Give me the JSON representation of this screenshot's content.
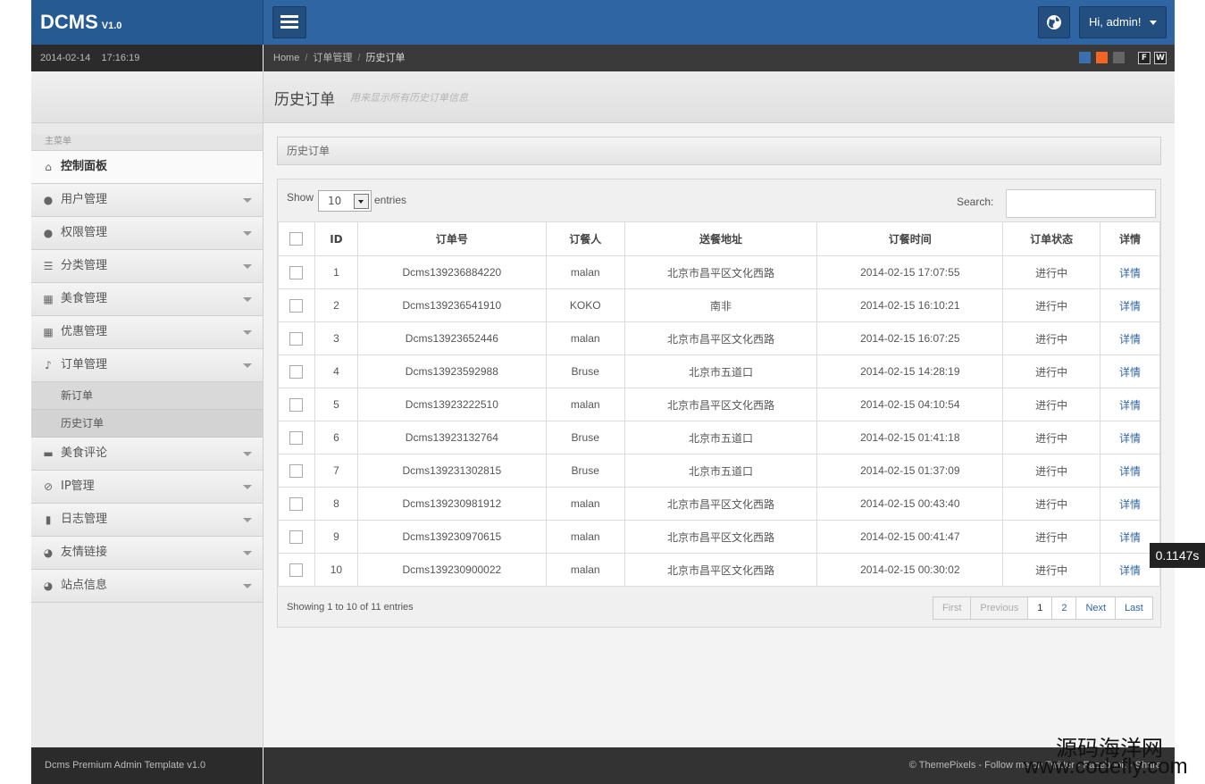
{
  "app": {
    "name": "DCMS",
    "version": "V1.0"
  },
  "header": {
    "datetime": "2014-02-14    17:16:19",
    "user_label": "Hi, admin!"
  },
  "breadcrumb": {
    "home": "Home",
    "section": "订单管理",
    "current": "历史订单"
  },
  "theme_colors": [
    "#3a6fb0",
    "#f26522",
    "#666666"
  ],
  "layout_buttons": [
    "F",
    "W"
  ],
  "sidebar": {
    "heading": "主菜单",
    "items": [
      {
        "label": "控制面板",
        "icon": "home-icon",
        "glyph": "⌂"
      },
      {
        "label": "用户管理",
        "icon": "user-icon",
        "glyph": "●"
      },
      {
        "label": "权限管理",
        "icon": "user-icon",
        "glyph": "●"
      },
      {
        "label": "分类管理",
        "icon": "list-icon",
        "glyph": "☰"
      },
      {
        "label": "美食管理",
        "icon": "grid-icon",
        "glyph": "▦"
      },
      {
        "label": "优惠管理",
        "icon": "grid-icon",
        "glyph": "▦"
      },
      {
        "label": "订单管理",
        "icon": "bell-icon",
        "glyph": "♪"
      }
    ],
    "subitems": [
      {
        "label": "新订单"
      },
      {
        "label": "历史订单"
      }
    ],
    "items2": [
      {
        "label": "美食评论",
        "icon": "comment-icon",
        "glyph": "▬"
      },
      {
        "label": "IP管理",
        "icon": "ban-icon",
        "glyph": "⊘"
      },
      {
        "label": "日志管理",
        "icon": "file-icon",
        "glyph": "▮"
      },
      {
        "label": "友情链接",
        "icon": "globe-icon",
        "glyph": "◕"
      },
      {
        "label": "站点信息",
        "icon": "globe-icon",
        "glyph": "◕"
      }
    ]
  },
  "page": {
    "title": "历史订单",
    "description": "用来显示所有历史订单信息",
    "box_title": "历史订单"
  },
  "table_controls": {
    "show": "Show",
    "length": "10",
    "entries": "entries",
    "search_label": "Search:",
    "search_value": ""
  },
  "table": {
    "headers": [
      "ID",
      "订单号",
      "订餐人",
      "送餐地址",
      "订餐时间",
      "订单状态",
      "详情"
    ],
    "rows": [
      {
        "id": "1",
        "order_no": "Dcms139236884220",
        "customer": "malan",
        "address": "北京市昌平区文化西路",
        "time": "2014-02-15 17:07:55",
        "status": "进行中",
        "detail": "详情"
      },
      {
        "id": "2",
        "order_no": "Dcms139236541910",
        "customer": "KOKO",
        "address": "南非",
        "time": "2014-02-15 16:10:21",
        "status": "进行中",
        "detail": "详情"
      },
      {
        "id": "3",
        "order_no": "Dcms13923652446",
        "customer": "malan",
        "address": "北京市昌平区文化西路",
        "time": "2014-02-15 16:07:25",
        "status": "进行中",
        "detail": "详情"
      },
      {
        "id": "4",
        "order_no": "Dcms13923592988",
        "customer": "Bruse",
        "address": "北京市五道口",
        "time": "2014-02-15 14:28:19",
        "status": "进行中",
        "detail": "详情"
      },
      {
        "id": "5",
        "order_no": "Dcms13923222510",
        "customer": "malan",
        "address": "北京市昌平区文化西路",
        "time": "2014-02-15 04:10:54",
        "status": "进行中",
        "detail": "详情"
      },
      {
        "id": "6",
        "order_no": "Dcms13923132764",
        "customer": "Bruse",
        "address": "北京市五道口",
        "time": "2014-02-15 01:41:18",
        "status": "进行中",
        "detail": "详情"
      },
      {
        "id": "7",
        "order_no": "Dcms139231302815",
        "customer": "Bruse",
        "address": "北京市五道口",
        "time": "2014-02-15 01:37:09",
        "status": "进行中",
        "detail": "详情"
      },
      {
        "id": "8",
        "order_no": "Dcms139230981912",
        "customer": "malan",
        "address": "北京市昌平区文化西路",
        "time": "2014-02-15 00:43:40",
        "status": "进行中",
        "detail": "详情"
      },
      {
        "id": "9",
        "order_no": "Dcms139230970615",
        "customer": "malan",
        "address": "北京市昌平区文化西路",
        "time": "2014-02-15 00:41:47",
        "status": "进行中",
        "detail": "详情"
      },
      {
        "id": "10",
        "order_no": "Dcms139230900022",
        "customer": "malan",
        "address": "北京市昌平区文化西路",
        "time": "2014-02-15 00:30:02",
        "status": "进行中",
        "detail": "详情"
      }
    ]
  },
  "pagination": {
    "info": "Showing 1 to 10 of 11 entries",
    "first": "First",
    "previous": "Previous",
    "pages": [
      "1",
      "2"
    ],
    "next": "Next",
    "last": "Last"
  },
  "timer": "0.1147s",
  "footer": {
    "left": "Dcms Premium Admin Template v1.0",
    "right": "© ThemePixels - Follow me on Twitter - Facebook - Share"
  },
  "watermark": {
    "line1": "源码海洋网",
    "line2": "www.codefly.com"
  }
}
